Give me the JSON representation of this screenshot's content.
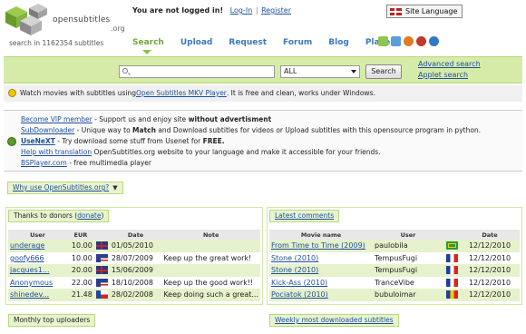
{
  "logo": {
    "text": "opensubtitles",
    "suffix": ".org"
  },
  "header": {
    "search_count": "search in 1162354 subtitles",
    "not_logged": "You are not logged in!",
    "login": "Log-In",
    "register": "Register",
    "site_language": "Site Language"
  },
  "nav": {
    "items": [
      "Search",
      "Upload",
      "Request",
      "Forum",
      "Blog",
      "Player"
    ],
    "active": "Search"
  },
  "search": {
    "select_value": "ALL",
    "button": "Search",
    "advanced": "Advanced search",
    "applet": "Applet search"
  },
  "mkv": {
    "pre": "Watch movies with subtitles using ",
    "link": "Open Subtitles MKV Player",
    "post": ". It is free and clean, works under Windows."
  },
  "info": [
    {
      "link": "Become VIP member",
      "text": " - Support us and enjoy site ",
      "bold": "without advertisment",
      "tail": ""
    },
    {
      "link": "SubDownloader",
      "text": " - Unique way to ",
      "bold": "Match",
      "tail": " and Download subtitles for videos or Upload subtitles with this opensource program in python."
    },
    {
      "link": "UseNeXT",
      "text": " - Try download some stuff from Usenet for ",
      "bold": "FREE.",
      "tail": ""
    },
    {
      "link": "Help with translation",
      "text": " OpenSubtitles.org website to your language and make it accessible for your friends.",
      "bold": "",
      "tail": ""
    },
    {
      "link": "BSPlayer.com",
      "text": " - free multimedia player",
      "bold": "",
      "tail": ""
    }
  ],
  "why": {
    "label": "Why use OpenSubtitles.org?"
  },
  "donors": {
    "title": "Thanks to donors",
    "donate": "donate",
    "headers": [
      "User",
      "EUR",
      "",
      "Date",
      "Note"
    ],
    "rows": [
      {
        "user": "underage",
        "eur": "10.00",
        "flag": "uk",
        "date": "01/05/2010",
        "note": ""
      },
      {
        "user": "goofy666",
        "eur": "10.00",
        "flag": "us",
        "date": "28/07/2009",
        "note": "Keep up the great work!"
      },
      {
        "user": "jacques1...",
        "eur": "20.00",
        "flag": "uk",
        "date": "15/06/2009",
        "note": ""
      },
      {
        "user": "Anonymous",
        "eur": "22.00",
        "flag": "us",
        "date": "18/10/2008",
        "note": "Keep up the good work!!"
      },
      {
        "user": "shinedev...",
        "eur": "21.48",
        "flag": "cz",
        "date": "28/02/2008",
        "note": "Keep doing such a great..."
      }
    ]
  },
  "comments": {
    "title": "Latest comments",
    "headers": [
      "Movie name",
      "User",
      "",
      "Date"
    ],
    "rows": [
      {
        "movie": "From Time to Time (2009)",
        "user": "paulobila",
        "flag": "br",
        "date": "12/12/2010"
      },
      {
        "movie": "Stone (2010)",
        "user": "TempusFugi",
        "flag": "fr",
        "date": "12/12/2010"
      },
      {
        "movie": "Stone (2010)",
        "user": "TempusFugi",
        "flag": "fr",
        "date": "12/12/2010"
      },
      {
        "movie": "Kick-Ass (2010)",
        "user": "TranceVibe",
        "flag": "fr",
        "date": "12/12/2010"
      },
      {
        "movie": "Pociatok (2010)",
        "user": "bubuloimar",
        "flag": "ro",
        "date": "12/12/2010"
      }
    ]
  },
  "bottom": {
    "uploaders": "Monthly top uploaders",
    "weekly": "Weekly most downloaded subtitles"
  }
}
